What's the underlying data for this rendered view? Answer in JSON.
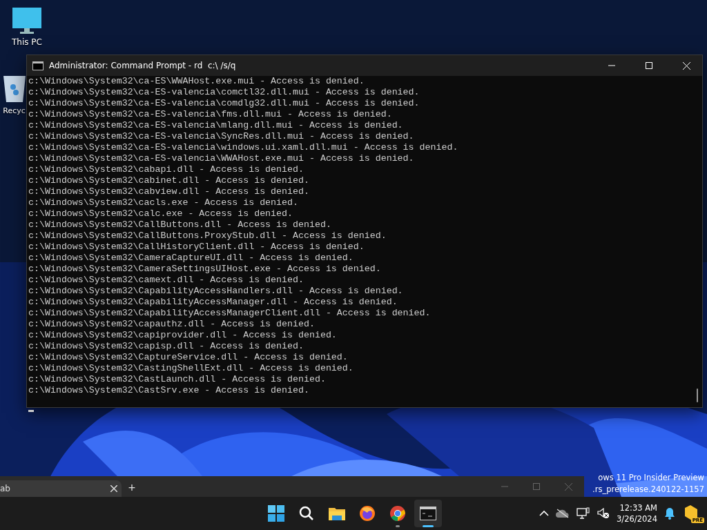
{
  "desktop_icons": [
    {
      "kind": "pc",
      "label": "This PC"
    },
    {
      "kind": "bin",
      "label": "Recyc"
    }
  ],
  "console": {
    "title": "Administrator: Command Prompt - rd  c:\\ /s/q",
    "lines": [
      "c:\\Windows\\System32\\ca-ES\\WWAHost.exe.mui - Access is denied.",
      "c:\\Windows\\System32\\ca-ES-valencia\\comctl32.dll.mui - Access is denied.",
      "c:\\Windows\\System32\\ca-ES-valencia\\comdlg32.dll.mui - Access is denied.",
      "c:\\Windows\\System32\\ca-ES-valencia\\fms.dll.mui - Access is denied.",
      "c:\\Windows\\System32\\ca-ES-valencia\\mlang.dll.mui - Access is denied.",
      "c:\\Windows\\System32\\ca-ES-valencia\\SyncRes.dll.mui - Access is denied.",
      "c:\\Windows\\System32\\ca-ES-valencia\\windows.ui.xaml.dll.mui - Access is denied.",
      "c:\\Windows\\System32\\ca-ES-valencia\\WWAHost.exe.mui - Access is denied.",
      "c:\\Windows\\System32\\cabapi.dll - Access is denied.",
      "c:\\Windows\\System32\\cabinet.dll - Access is denied.",
      "c:\\Windows\\System32\\cabview.dll - Access is denied.",
      "c:\\Windows\\System32\\cacls.exe - Access is denied.",
      "c:\\Windows\\System32\\calc.exe - Access is denied.",
      "c:\\Windows\\System32\\CallButtons.dll - Access is denied.",
      "c:\\Windows\\System32\\CallButtons.ProxyStub.dll - Access is denied.",
      "c:\\Windows\\System32\\CallHistoryClient.dll - Access is denied.",
      "c:\\Windows\\System32\\CameraCaptureUI.dll - Access is denied.",
      "c:\\Windows\\System32\\CameraSettingsUIHost.exe - Access is denied.",
      "c:\\Windows\\System32\\camext.dll - Access is denied.",
      "c:\\Windows\\System32\\CapabilityAccessHandlers.dll - Access is denied.",
      "c:\\Windows\\System32\\CapabilityAccessManager.dll - Access is denied.",
      "c:\\Windows\\System32\\CapabilityAccessManagerClient.dll - Access is denied.",
      "c:\\Windows\\System32\\capauthz.dll - Access is denied.",
      "c:\\Windows\\System32\\capiprovider.dll - Access is denied.",
      "c:\\Windows\\System32\\capisp.dll - Access is denied.",
      "c:\\Windows\\System32\\CaptureService.dll - Access is denied.",
      "c:\\Windows\\System32\\CastingShellExt.dll - Access is denied.",
      "c:\\Windows\\System32\\CastLaunch.dll - Access is denied.",
      "c:\\Windows\\System32\\CastSrv.exe - Access is denied."
    ]
  },
  "browser_strip": {
    "tab": {
      "label": "ab",
      "selected": true
    },
    "new_tab": "+"
  },
  "watermark": [
    "ows 11 Pro Insider Preview",
    ".rs_prerelease.240122-1157"
  ],
  "taskbar": {
    "apps": [
      {
        "kind": "start",
        "active": false
      },
      {
        "kind": "search",
        "active": false
      },
      {
        "kind": "files",
        "active": false
      },
      {
        "kind": "firefox",
        "active": false
      },
      {
        "kind": "chrome",
        "active": false,
        "running": true
      },
      {
        "kind": "terminal",
        "active": true,
        "running": true
      }
    ],
    "tray": {
      "time": "12:33 AM",
      "date": "3/26/2024",
      "badge": "PRE"
    }
  }
}
